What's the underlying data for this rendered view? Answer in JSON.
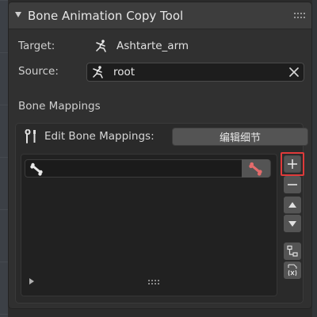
{
  "panel": {
    "title": "Bone Animation Copy Tool"
  },
  "target": {
    "label": "Target:",
    "value": "Ashtarte_arm"
  },
  "source": {
    "label": "Source:",
    "value": "root"
  },
  "mappings": {
    "section_label": "Bone Mappings",
    "edit_label": "Edit Bone Mappings:",
    "edit_button_label": "编辑细节"
  },
  "icons": {
    "collapse": "triangle-down-icon",
    "drag": "grip-dots-icon",
    "armature": "armature-icon",
    "clear": "close-icon",
    "tools": "wrench-screwdriver-icon",
    "bone": "bone-icon",
    "add": "plus-icon",
    "remove": "minus-icon",
    "up": "move-up-icon",
    "down": "move-down-icon",
    "hierarchy": "hierarchy-icon",
    "driver": "function-icon"
  },
  "colors": {
    "highlight": "#e03a3a",
    "bone_red": "#e36b6b",
    "panel_bg": "#303030"
  }
}
